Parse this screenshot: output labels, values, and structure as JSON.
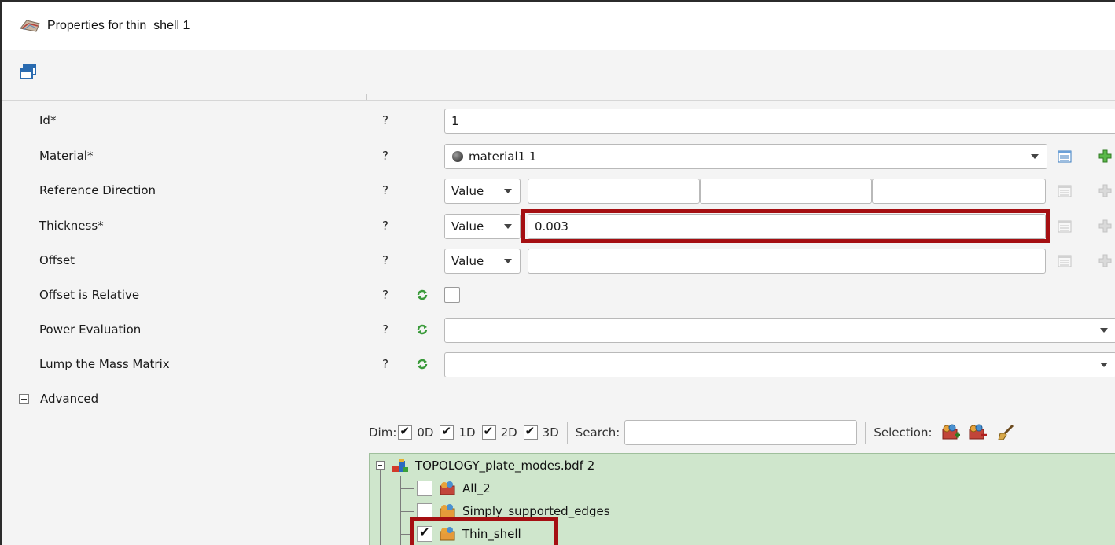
{
  "window": {
    "title": "Properties for thin_shell 1"
  },
  "properties": {
    "id": {
      "label": "Id*",
      "help": "?",
      "value": "1"
    },
    "material": {
      "label": "Material*",
      "help": "?",
      "value": "material1 1"
    },
    "reference_direction": {
      "label": "Reference Direction",
      "help": "?",
      "mode": "Value",
      "values": [
        "",
        "",
        ""
      ]
    },
    "thickness": {
      "label": "Thickness*",
      "help": "?",
      "mode": "Value",
      "value": "0.003"
    },
    "offset": {
      "label": "Offset",
      "help": "?",
      "mode": "Value",
      "value": ""
    },
    "offset_is_relative": {
      "label": "Offset is Relative",
      "help": "?",
      "checked": false
    },
    "power_evaluation": {
      "label": "Power Evaluation",
      "help": "?",
      "value": ""
    },
    "lump_mass_matrix": {
      "label": "Lump the Mass Matrix",
      "help": "?",
      "value": ""
    }
  },
  "advanced": {
    "label": "Advanced"
  },
  "filter": {
    "dim_label": "Dim:",
    "dims": [
      {
        "label": "0D",
        "checked": true
      },
      {
        "label": "1D",
        "checked": true
      },
      {
        "label": "2D",
        "checked": true
      },
      {
        "label": "3D",
        "checked": true
      }
    ],
    "search_label": "Search:",
    "search_value": "",
    "selection_label": "Selection:"
  },
  "tree": {
    "root": {
      "label": "TOPOLOGY_plate_modes.bdf 2"
    },
    "children": [
      {
        "label": "All_2",
        "checked": false
      },
      {
        "label": "Simply_supported_edges",
        "checked": false
      },
      {
        "label": "Thin_shell",
        "checked": true
      }
    ]
  },
  "colors": {
    "highlight": "#a50f12",
    "tree_bg": "#cfe6cc",
    "panel_bg": "#f4f4f4"
  }
}
